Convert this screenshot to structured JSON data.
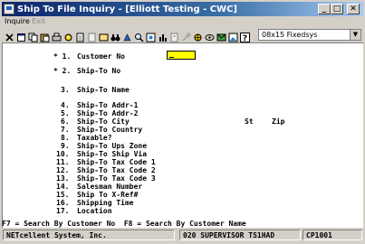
{
  "window": {
    "title": "Ship To File Inquiry - [Elliott Testing - CWC]",
    "minimize": "_",
    "maximize": "□",
    "close": "✕"
  },
  "menu": {
    "inquire": "Inquire",
    "exit": "Exit"
  },
  "toolbar": {
    "icons": [
      "close-icon",
      "restore-icon",
      "copy-icon",
      "paste-icon",
      "print-icon",
      "settings-icon",
      "document-icon",
      "file-icon",
      "find-icon",
      "binoculars-icon",
      "search-icon",
      "zoom-icon",
      "image-icon",
      "chart-icon",
      "phone-icon",
      "key-icon",
      "tools-icon",
      "link-icon",
      "mail-icon",
      "image2-icon",
      "help-icon"
    ],
    "font_value": "08x15 Fixedsys",
    "font_arrow": "▼"
  },
  "form": {
    "fields": [
      {
        "prefix": "* 1.",
        "label": "Customer No"
      },
      {
        "prefix": "* 2.",
        "label": "Ship-To No"
      },
      {
        "prefix": "3.",
        "label": "Ship-To Name"
      },
      {
        "prefix": "4.",
        "label": "Ship-To Addr-1"
      },
      {
        "prefix": "5.",
        "label": "Ship-To Addr-2"
      },
      {
        "prefix": "6.",
        "label": "Ship-To City"
      },
      {
        "prefix": "7.",
        "label": "Ship-To Country"
      },
      {
        "prefix": "8.",
        "label": "Taxable?"
      },
      {
        "prefix": "9.",
        "label": "Ship-To Ups Zone"
      },
      {
        "prefix": "10.",
        "label": "Ship-To Ship Via"
      },
      {
        "prefix": "11.",
        "label": "Ship-To Tax Code 1"
      },
      {
        "prefix": "12.",
        "label": "Ship-To Tax Code 2"
      },
      {
        "prefix": "13.",
        "label": "Ship-To Tax Code 3"
      },
      {
        "prefix": "14.",
        "label": "Salesman Number"
      },
      {
        "prefix": "15.",
        "label": "Ship To X-Ref#"
      },
      {
        "prefix": "16.",
        "label": "Shipping Time"
      },
      {
        "prefix": "17.",
        "label": "Location"
      }
    ],
    "st_label": "St",
    "zip_label": "Zip",
    "customer_value": ""
  },
  "function_keys": "F7 = Search By Customer No  F8 = Search By Customer Name",
  "status": {
    "company": "NETcellent System, Inc.",
    "user": "020 SUPERVISOR TS1HAD",
    "program": "CP1001"
  }
}
